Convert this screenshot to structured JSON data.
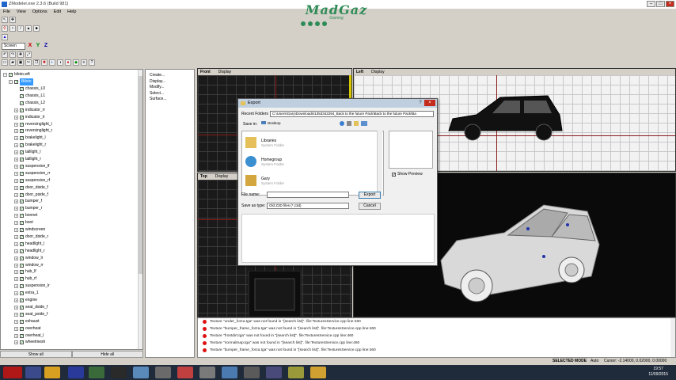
{
  "window": {
    "title": "ZModeler.exe 2.3.6 (Build 981)"
  },
  "banner": {
    "logo": "MadGaz",
    "subtitle": "Gaming"
  },
  "menu": [
    "File",
    "View",
    "Options",
    "Edit",
    "Help"
  ],
  "toolbar": {
    "view_combo": "Screen",
    "axes": [
      "X",
      "Y",
      "Z"
    ]
  },
  "tree": {
    "root": "biloto.wft",
    "selected": "Biloto",
    "items": [
      "chassis_L0",
      "chassis_L1",
      "chassis_L2",
      "indicator_rr",
      "indicator_lr",
      "reversinglight_l",
      "reversinglight_r",
      "brakelight_l",
      "brakelight_r",
      "taillight_l",
      "taillight_r",
      "suspension_lf",
      "suspension_rr",
      "suspension_rf",
      "door_dside_f",
      "door_pside_f",
      "bumper_f",
      "bumper_r",
      "bonnet",
      "boot",
      "windscreen",
      "door_dside_r",
      "headlight_l",
      "headlight_r",
      "window_lr",
      "window_rr",
      "hub_lf",
      "hub_rf",
      "suspension_lr",
      "extra_1",
      "engine",
      "seat_dside_f",
      "seat_pside_f",
      "exhaust",
      "overheat",
      "overheat_l",
      "wheelmesh"
    ],
    "show_all": "Show all",
    "hide_all": "Hide all"
  },
  "commands": [
    "Create...",
    "Display...",
    "Modify...",
    "Select...",
    "Surface..."
  ],
  "viewports": {
    "front": {
      "label": "Front",
      "mode": "Display"
    },
    "left": {
      "label": "Left",
      "mode": "Display"
    },
    "top": {
      "label": "Top",
      "mode": "Display"
    }
  },
  "dialog": {
    "title": "Export",
    "recent_label": "Recent Folders",
    "recent_path": "C:\\Users\\Gary\\Downloads\\1353342294_Back to the future Pack\\Back to the future Pack\\Ba",
    "save_in_label": "Save in:",
    "save_in_value": "Desktop",
    "places": [
      {
        "name": "Libraries",
        "type": "System Folder"
      },
      {
        "name": "Homegroup",
        "type": "System Folder"
      },
      {
        "name": "Gary",
        "type": "System Folder"
      }
    ],
    "show_preview": "Show Preview",
    "file_name_label": "File name:",
    "file_name_value": "",
    "save_type_label": "Save as type:",
    "save_type_value": "Old Z3D files (*.z3d)",
    "export_btn": "Export",
    "cancel_btn": "Cancel"
  },
  "log": [
    "Texture \"under_forza.tga\" was not found in \"[search list]\". file:TexturesService.cpp line:460",
    "Texture \"bumper_frame_forza.tga\" was not found in \"[search list]\". file:TexturesService.cpp line:460",
    "Texture \"frontdirt.tga\" was not found in \"[search list]\". file:TexturesService.cpp line:460",
    "Texture \"normalmap.tga\" was not found in \"[search list]\". file:TexturesService.cpp line:460",
    "Texture \"bumper_frame_forza.tga\" was not found in \"[search list]\". file:TexturesService.cpp line:460"
  ],
  "status": {
    "mode": "SELECTED MODE",
    "auto": "Auto",
    "cursor": "Cursor: -2.14000, 0.02000, 0.00000"
  },
  "clock": {
    "time": "19:57",
    "date": "11/09/2015"
  },
  "colors": {
    "accent": "#3399ff",
    "error": "#dd1111",
    "banner": "#2e8b57"
  }
}
